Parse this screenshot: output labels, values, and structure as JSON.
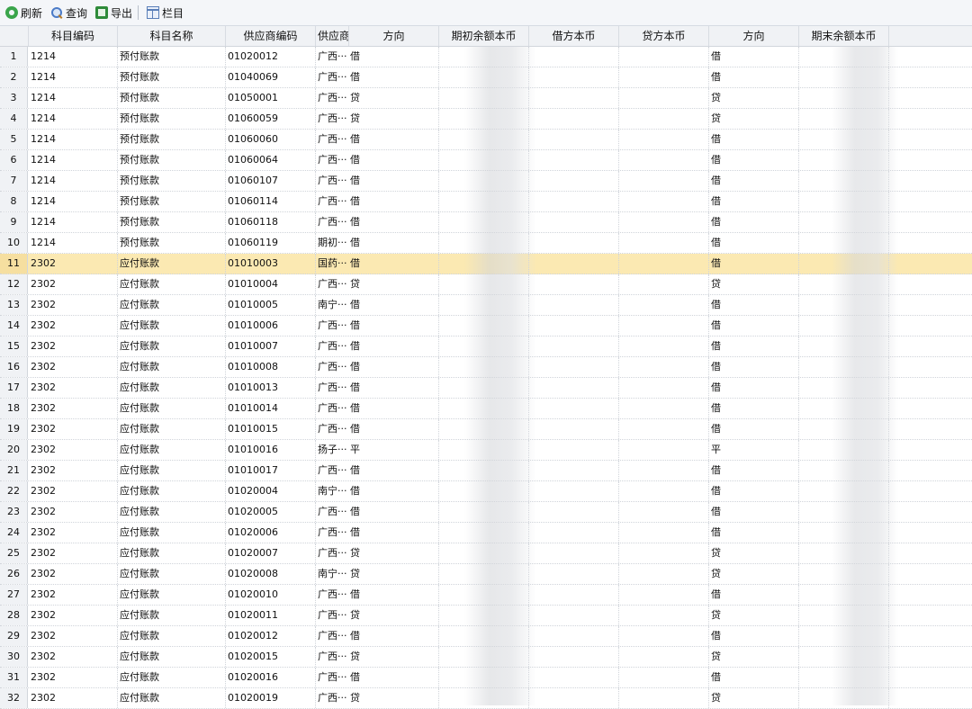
{
  "toolbar": {
    "buttons": [
      {
        "label": "刷新",
        "icon": "refresh-icon"
      },
      {
        "label": "查询",
        "icon": "search-icon"
      },
      {
        "label": "导出",
        "icon": "export-icon"
      },
      {
        "label": "栏目",
        "icon": "columns-icon"
      }
    ]
  },
  "columns": [
    "科目编码",
    "科目名称",
    "供应商编码",
    "供应商",
    "方向",
    "期初余额本币",
    "借方本币",
    "贷方本币",
    "方向",
    "期末余额本币"
  ],
  "selected_row": 11,
  "rows": [
    {
      "n": "1",
      "code": "1214",
      "name": "预付账款",
      "sup_code": "01020012",
      "sup": "广西···",
      "dir": "借",
      "dir2": "借"
    },
    {
      "n": "2",
      "code": "1214",
      "name": "预付账款",
      "sup_code": "01040069",
      "sup": "广西···",
      "dir": "借",
      "dir2": "借"
    },
    {
      "n": "3",
      "code": "1214",
      "name": "预付账款",
      "sup_code": "01050001",
      "sup": "广西···",
      "dir": "贷",
      "dir2": "贷"
    },
    {
      "n": "4",
      "code": "1214",
      "name": "预付账款",
      "sup_code": "01060059",
      "sup": "广西···",
      "dir": "贷",
      "dir2": "贷"
    },
    {
      "n": "5",
      "code": "1214",
      "name": "预付账款",
      "sup_code": "01060060",
      "sup": "广西···",
      "dir": "借",
      "dir2": "借"
    },
    {
      "n": "6",
      "code": "1214",
      "name": "预付账款",
      "sup_code": "01060064",
      "sup": "广西···",
      "dir": "借",
      "dir2": "借"
    },
    {
      "n": "7",
      "code": "1214",
      "name": "预付账款",
      "sup_code": "01060107",
      "sup": "广西···",
      "dir": "借",
      "dir2": "借"
    },
    {
      "n": "8",
      "code": "1214",
      "name": "预付账款",
      "sup_code": "01060114",
      "sup": "广西···",
      "dir": "借",
      "dir2": "借"
    },
    {
      "n": "9",
      "code": "1214",
      "name": "预付账款",
      "sup_code": "01060118",
      "sup": "广西···",
      "dir": "借",
      "dir2": "借"
    },
    {
      "n": "10",
      "code": "1214",
      "name": "预付账款",
      "sup_code": "01060119",
      "sup": "期初···",
      "dir": "借",
      "dir2": "借"
    },
    {
      "n": "11",
      "code": "2302",
      "name": "应付账款",
      "sup_code": "01010003",
      "sup": "国药···",
      "dir": "借",
      "dir2": "借"
    },
    {
      "n": "12",
      "code": "2302",
      "name": "应付账款",
      "sup_code": "01010004",
      "sup": "广西···",
      "dir": "贷",
      "dir2": "贷"
    },
    {
      "n": "13",
      "code": "2302",
      "name": "应付账款",
      "sup_code": "01010005",
      "sup": "南宁···",
      "dir": "借",
      "dir2": "借"
    },
    {
      "n": "14",
      "code": "2302",
      "name": "应付账款",
      "sup_code": "01010006",
      "sup": "广西···",
      "dir": "借",
      "dir2": "借"
    },
    {
      "n": "15",
      "code": "2302",
      "name": "应付账款",
      "sup_code": "01010007",
      "sup": "广西···",
      "dir": "借",
      "dir2": "借"
    },
    {
      "n": "16",
      "code": "2302",
      "name": "应付账款",
      "sup_code": "01010008",
      "sup": "广西···",
      "dir": "借",
      "dir2": "借"
    },
    {
      "n": "17",
      "code": "2302",
      "name": "应付账款",
      "sup_code": "01010013",
      "sup": "广西···",
      "dir": "借",
      "dir2": "借"
    },
    {
      "n": "18",
      "code": "2302",
      "name": "应付账款",
      "sup_code": "01010014",
      "sup": "广西···",
      "dir": "借",
      "dir2": "借"
    },
    {
      "n": "19",
      "code": "2302",
      "name": "应付账款",
      "sup_code": "01010015",
      "sup": "广西···",
      "dir": "借",
      "dir2": "借"
    },
    {
      "n": "20",
      "code": "2302",
      "name": "应付账款",
      "sup_code": "01010016",
      "sup": "扬子···",
      "dir": "平",
      "dir2": "平"
    },
    {
      "n": "21",
      "code": "2302",
      "name": "应付账款",
      "sup_code": "01010017",
      "sup": "广西···",
      "dir": "借",
      "dir2": "借"
    },
    {
      "n": "22",
      "code": "2302",
      "name": "应付账款",
      "sup_code": "01020004",
      "sup": "南宁···",
      "dir": "借",
      "dir2": "借"
    },
    {
      "n": "23",
      "code": "2302",
      "name": "应付账款",
      "sup_code": "01020005",
      "sup": "广西···",
      "dir": "借",
      "dir2": "借"
    },
    {
      "n": "24",
      "code": "2302",
      "name": "应付账款",
      "sup_code": "01020006",
      "sup": "广西···",
      "dir": "借",
      "dir2": "借"
    },
    {
      "n": "25",
      "code": "2302",
      "name": "应付账款",
      "sup_code": "01020007",
      "sup": "广西···",
      "dir": "贷",
      "dir2": "贷"
    },
    {
      "n": "26",
      "code": "2302",
      "name": "应付账款",
      "sup_code": "01020008",
      "sup": "南宁···",
      "dir": "贷",
      "dir2": "贷"
    },
    {
      "n": "27",
      "code": "2302",
      "name": "应付账款",
      "sup_code": "01020010",
      "sup": "广西···",
      "dir": "借",
      "dir2": "借"
    },
    {
      "n": "28",
      "code": "2302",
      "name": "应付账款",
      "sup_code": "01020011",
      "sup": "广西···",
      "dir": "贷",
      "dir2": "贷"
    },
    {
      "n": "29",
      "code": "2302",
      "name": "应付账款",
      "sup_code": "01020012",
      "sup": "广西···",
      "dir": "借",
      "dir2": "借"
    },
    {
      "n": "30",
      "code": "2302",
      "name": "应付账款",
      "sup_code": "01020015",
      "sup": "广西···",
      "dir": "贷",
      "dir2": "贷"
    },
    {
      "n": "31",
      "code": "2302",
      "name": "应付账款",
      "sup_code": "01020016",
      "sup": "广西···",
      "dir": "借",
      "dir2": "借"
    },
    {
      "n": "32",
      "code": "2302",
      "name": "应付账款",
      "sup_code": "01020019",
      "sup": "广西···",
      "dir": "贷",
      "dir2": "贷"
    }
  ]
}
